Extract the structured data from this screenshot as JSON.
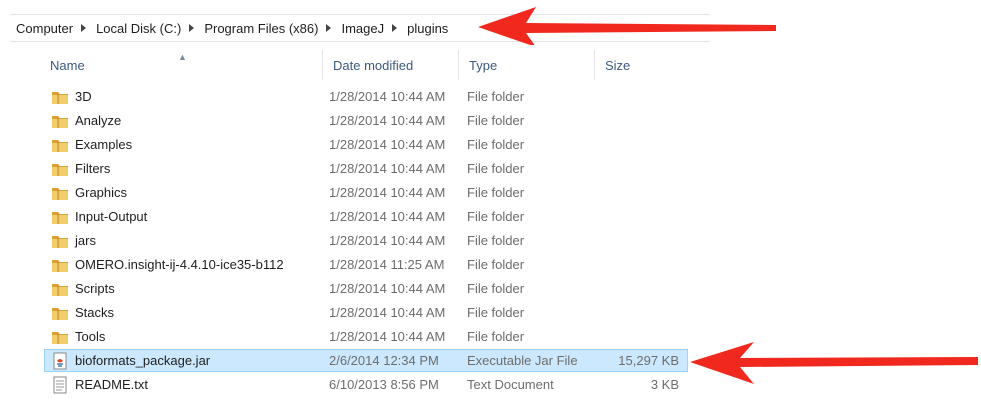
{
  "breadcrumb": {
    "items": [
      "Computer",
      "Local Disk (C:)",
      "Program Files (x86)",
      "ImageJ",
      "plugins"
    ]
  },
  "columns": {
    "name": "Name",
    "date": "Date modified",
    "type": "Type",
    "size": "Size"
  },
  "files": [
    {
      "name": "3D",
      "date": "1/28/2014 10:44 AM",
      "type": "File folder",
      "size": "",
      "icon": "folder-icon"
    },
    {
      "name": "Analyze",
      "date": "1/28/2014 10:44 AM",
      "type": "File folder",
      "size": "",
      "icon": "folder-icon"
    },
    {
      "name": "Examples",
      "date": "1/28/2014 10:44 AM",
      "type": "File folder",
      "size": "",
      "icon": "folder-icon"
    },
    {
      "name": "Filters",
      "date": "1/28/2014 10:44 AM",
      "type": "File folder",
      "size": "",
      "icon": "folder-icon"
    },
    {
      "name": "Graphics",
      "date": "1/28/2014 10:44 AM",
      "type": "File folder",
      "size": "",
      "icon": "folder-icon"
    },
    {
      "name": "Input-Output",
      "date": "1/28/2014 10:44 AM",
      "type": "File folder",
      "size": "",
      "icon": "folder-icon"
    },
    {
      "name": "jars",
      "date": "1/28/2014 10:44 AM",
      "type": "File folder",
      "size": "",
      "icon": "folder-icon"
    },
    {
      "name": "OMERO.insight-ij-4.4.10-ice35-b112",
      "date": "1/28/2014 11:25 AM",
      "type": "File folder",
      "size": "",
      "icon": "folder-icon"
    },
    {
      "name": "Scripts",
      "date": "1/28/2014 10:44 AM",
      "type": "File folder",
      "size": "",
      "icon": "folder-icon"
    },
    {
      "name": "Stacks",
      "date": "1/28/2014 10:44 AM",
      "type": "File folder",
      "size": "",
      "icon": "folder-icon"
    },
    {
      "name": "Tools",
      "date": "1/28/2014 10:44 AM",
      "type": "File folder",
      "size": "",
      "icon": "folder-icon"
    },
    {
      "name": "bioformats_package.jar",
      "date": "2/6/2014 12:34 PM",
      "type": "Executable Jar File",
      "size": "15,297 KB",
      "icon": "jar-file-icon",
      "selected": true
    },
    {
      "name": "README.txt",
      "date": "6/10/2013 8:56 PM",
      "type": "Text Document",
      "size": "3 KB",
      "icon": "text-file-icon"
    }
  ],
  "colors": {
    "selection_bg": "#cce8ff",
    "selection_border": "#99d1ff",
    "annotation_arrow": "#f0281e",
    "folder": "#e8b84a"
  },
  "annotations": [
    "red-arrow-pointing-to-breadcrumb",
    "red-arrow-pointing-to-jar-file"
  ]
}
